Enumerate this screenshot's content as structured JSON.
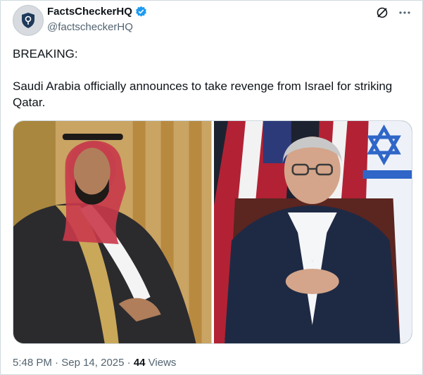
{
  "account": {
    "name": "FactsCheckerHQ",
    "handle": "@factscheckerHQ"
  },
  "post": {
    "line1": "BREAKING:",
    "line2": "Saudi Arabia officially announces to take revenge from Israel for striking Qatar."
  },
  "meta": {
    "time": "5:48 PM",
    "sep1": " · ",
    "date": "Sep 14, 2025",
    "sep2": " · ",
    "views_count": "44",
    "views_label": " Views"
  },
  "colors": {
    "verified": "#1d9bf0",
    "muted": "#536471",
    "text": "#0f1419"
  },
  "icons": [
    "shield-logo-icon",
    "verified-badge-icon",
    "grok-icon",
    "more-icon"
  ]
}
